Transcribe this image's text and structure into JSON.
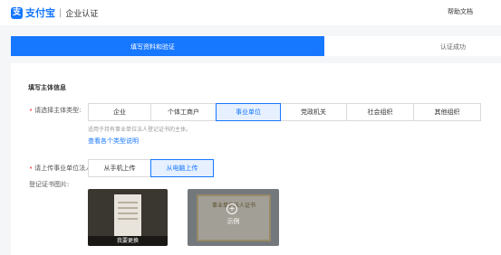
{
  "header": {
    "logo_mark": "支",
    "brand": "支付宝",
    "separator": "|",
    "subtitle": "企业认证",
    "help": "帮助文档"
  },
  "steps": [
    {
      "label": "填写资料和验证",
      "active": true
    },
    {
      "label": "认证成功",
      "active": false
    }
  ],
  "form": {
    "section_title": "填写主体信息",
    "required_mark": "•",
    "entity_type": {
      "label": "请选择主体类型:",
      "options": [
        "企业",
        "个体工商户",
        "事业单位",
        "党政机关",
        "社会组织",
        "其他组织"
      ],
      "selected": "事业单位",
      "helper": "适用于持有事业单位法人登记证书的主体。",
      "link": "查看各个类型说明"
    },
    "upload": {
      "label": "请上传事业单位法人登记证书图片:",
      "options": [
        "从手机上传",
        "从电脑上传"
      ],
      "selected": "从电脑上传",
      "thumb1_caption": "我要更换",
      "thumb2_title": "事业单位法人证书",
      "thumb2_plus": "+",
      "thumb2_caption": "示例"
    }
  },
  "colors": {
    "accent": "#1677ff",
    "required": "#ff4d4f"
  }
}
